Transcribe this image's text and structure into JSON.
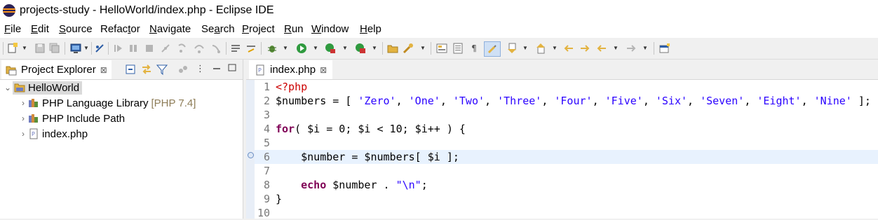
{
  "window": {
    "title": "projects-study - HelloWorld/index.php - Eclipse IDE"
  },
  "menu": [
    {
      "pre": "",
      "u": "F",
      "post": "ile"
    },
    {
      "pre": "",
      "u": "E",
      "post": "dit"
    },
    {
      "pre": "",
      "u": "S",
      "post": "ource"
    },
    {
      "pre": "Refac",
      "u": "t",
      "post": "or"
    },
    {
      "pre": "",
      "u": "N",
      "post": "avigate"
    },
    {
      "pre": "Se",
      "u": "a",
      "post": "rch"
    },
    {
      "pre": "",
      "u": "P",
      "post": "roject"
    },
    {
      "pre": "",
      "u": "R",
      "post": "un"
    },
    {
      "pre": "",
      "u": "W",
      "post": "indow"
    },
    {
      "pre": "",
      "u": "H",
      "post": "elp"
    }
  ],
  "project_explorer": {
    "tab_label": "Project Explorer",
    "close_glyph": "⊠",
    "tree": {
      "project": "HelloWorld",
      "children": [
        {
          "label": "PHP Language Library",
          "decoration": "[PHP 7.4]"
        },
        {
          "label": "PHP Include Path",
          "decoration": ""
        },
        {
          "label": "index.php",
          "decoration": ""
        }
      ]
    }
  },
  "editor": {
    "tab_label": "index.php",
    "close_glyph": "⊠",
    "line_numbers": [
      "1",
      "2",
      "3",
      "4",
      "5",
      "6",
      "7",
      "8",
      "9",
      "10"
    ],
    "line2": {
      "var": "$numbers",
      "op": " = [ ",
      "strings": [
        "'Zero'",
        "'One'",
        "'Two'",
        "'Three'",
        "'Four'",
        "'Five'",
        "'Six'",
        "'Seven'",
        "'Eight'",
        "'Nine'"
      ],
      "sep": ", ",
      "end": " ];"
    },
    "line1": {
      "tag": "<?php"
    },
    "line4": {
      "kw": "for",
      "rest": "( $i = 0; $i < 10; $i++ ) {"
    },
    "line6": {
      "indent": "    ",
      "text": "$number = $numbers[ $i ];"
    },
    "line8": {
      "indent": "    ",
      "kw": "echo",
      "mid": " $number . ",
      "str": "\"\\n\"",
      "end": ";"
    },
    "line9": {
      "text": "}"
    }
  }
}
